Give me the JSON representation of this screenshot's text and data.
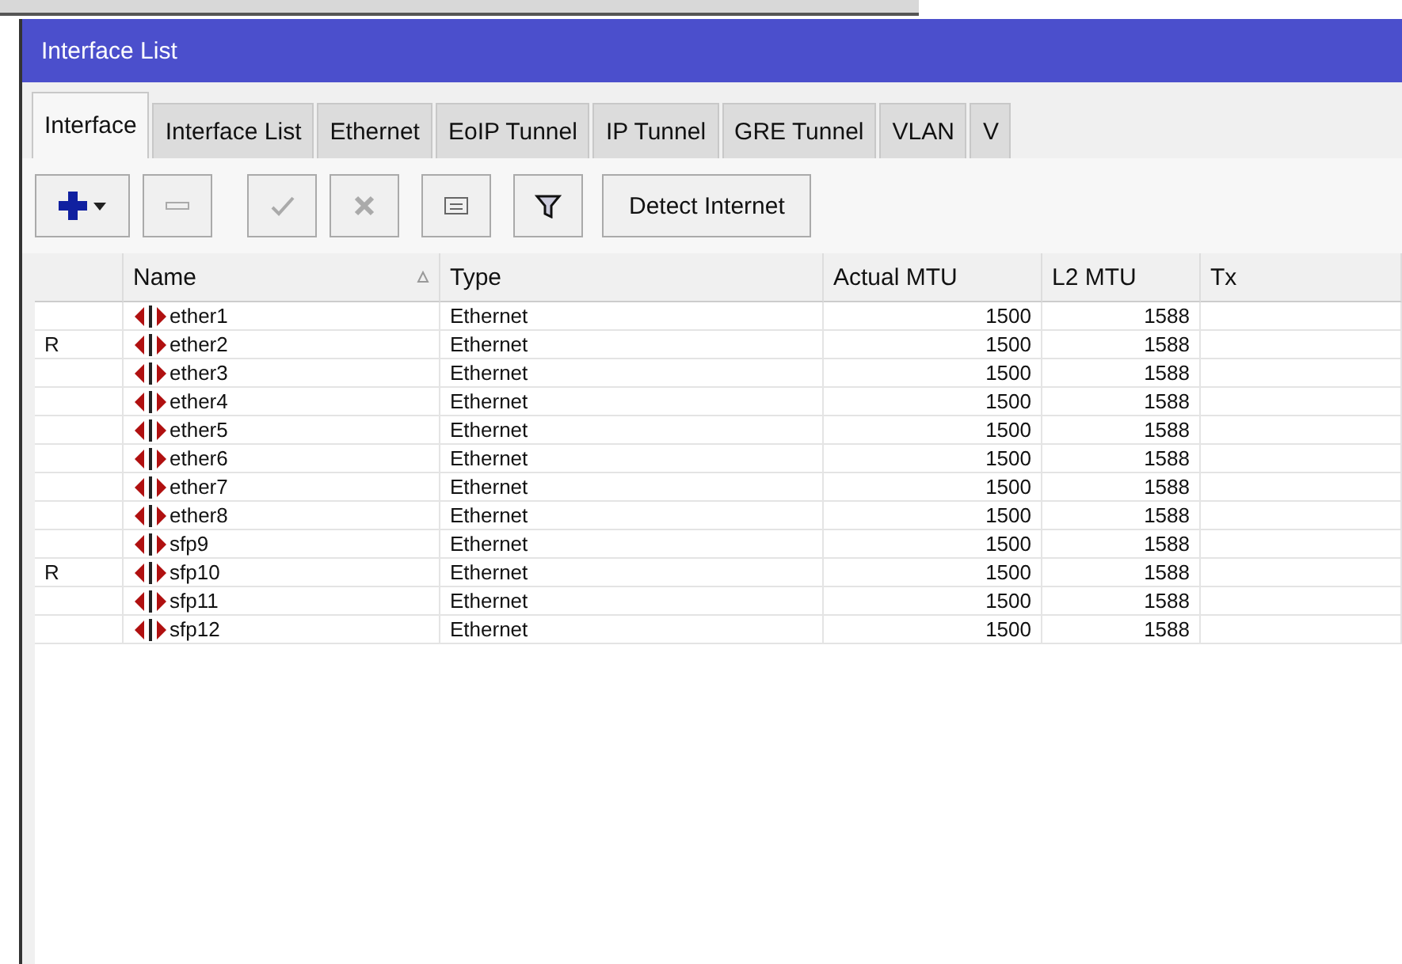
{
  "window": {
    "title": "Interface List"
  },
  "tabs": [
    {
      "label": "Interface",
      "selected": true
    },
    {
      "label": "Interface List",
      "selected": false
    },
    {
      "label": "Ethernet",
      "selected": false
    },
    {
      "label": "EoIP Tunnel",
      "selected": false
    },
    {
      "label": "IP Tunnel",
      "selected": false
    },
    {
      "label": "GRE Tunnel",
      "selected": false
    },
    {
      "label": "VLAN",
      "selected": false
    },
    {
      "label": "V",
      "selected": false
    }
  ],
  "toolbar": {
    "detect_button": "Detect Internet"
  },
  "table": {
    "columns": [
      "Name",
      "Type",
      "Actual MTU",
      "L2 MTU",
      "Tx"
    ],
    "rows": [
      {
        "name": "ether1",
        "type": "Ethernet",
        "actual_mtu": "1500",
        "l2_mtu": "1588"
      },
      {
        "flag": "R",
        "name": "ether2",
        "type": "Ethernet",
        "actual_mtu": "1500",
        "l2_mtu": "1588"
      },
      {
        "name": "ether3",
        "type": "Ethernet",
        "actual_mtu": "1500",
        "l2_mtu": "1588"
      },
      {
        "name": "ether4",
        "type": "Ethernet",
        "actual_mtu": "1500",
        "l2_mtu": "1588"
      },
      {
        "name": "ether5",
        "type": "Ethernet",
        "actual_mtu": "1500",
        "l2_mtu": "1588"
      },
      {
        "name": "ether6",
        "type": "Ethernet",
        "actual_mtu": "1500",
        "l2_mtu": "1588"
      },
      {
        "name": "ether7",
        "type": "Ethernet",
        "actual_mtu": "1500",
        "l2_mtu": "1588"
      },
      {
        "name": "ether8",
        "type": "Ethernet",
        "actual_mtu": "1500",
        "l2_mtu": "1588"
      },
      {
        "name": "sfp9",
        "type": "Ethernet",
        "actual_mtu": "1500",
        "l2_mtu": "1588"
      },
      {
        "flag": "R",
        "name": "sfp10",
        "type": "Ethernet",
        "actual_mtu": "1500",
        "l2_mtu": "1588"
      },
      {
        "name": "sfp11",
        "type": "Ethernet",
        "actual_mtu": "1500",
        "l2_mtu": "1588"
      },
      {
        "name": "sfp12",
        "type": "Ethernet",
        "actual_mtu": "1500",
        "l2_mtu": "1588"
      }
    ]
  }
}
